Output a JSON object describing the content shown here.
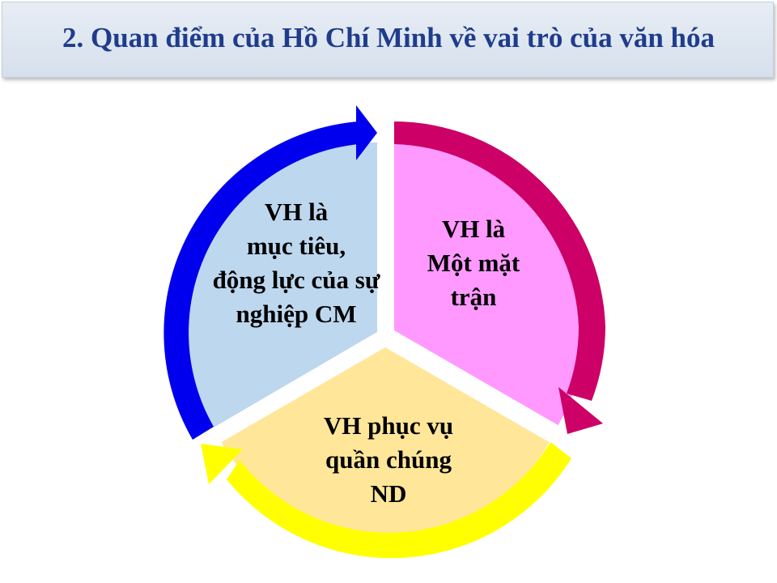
{
  "title": "2. Quan điểm của Hồ Chí Minh về vai trò của văn hóa",
  "colors": {
    "title_text": "#1f3c8c",
    "left_fill": "#bdd7ee",
    "right_fill": "#ff99ff",
    "bottom_fill": "#ffe699",
    "left_arrow": "#0000ee",
    "right_arrow": "#cc0066",
    "bottom_arrow": "#ffff00"
  },
  "segments": {
    "left": {
      "lines": [
        "VH là",
        "mục tiêu,",
        "động lực của sự",
        "nghiệp CM"
      ]
    },
    "right": {
      "lines": [
        "VH là",
        "Một mặt",
        "trận"
      ]
    },
    "bottom": {
      "lines": [
        "VH phục vụ",
        "quần chúng",
        "ND"
      ]
    }
  }
}
